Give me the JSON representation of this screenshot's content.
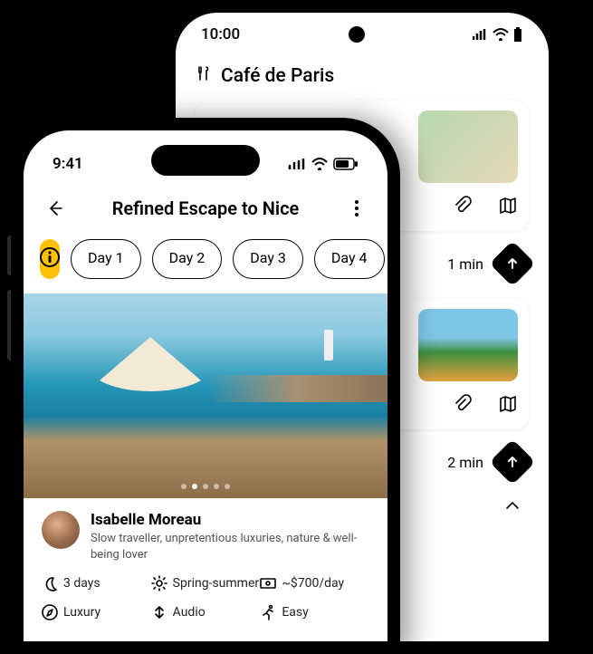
{
  "back": {
    "time": "10:00",
    "header_icon": "utensils-icon",
    "header_title": "Café de Paris",
    "rows": [
      {
        "duration": "1 min"
      },
      {
        "duration": "2 min"
      }
    ]
  },
  "front": {
    "time": "9:41",
    "title": "Refined Escape to Nice",
    "chips": [
      "Day 1",
      "Day 2",
      "Day 3",
      "Day 4"
    ],
    "carousel": {
      "count": 5,
      "index": 1
    },
    "author": {
      "name": "Isabelle Moreau",
      "bio": "Slow traveller, unpretentious luxuries, nature & well-being lover"
    },
    "meta": {
      "duration": "3 days",
      "season": "Spring-summer",
      "budget": "~$700/day",
      "style": "Luxury",
      "media": "Audio",
      "difficulty": "Easy"
    }
  }
}
